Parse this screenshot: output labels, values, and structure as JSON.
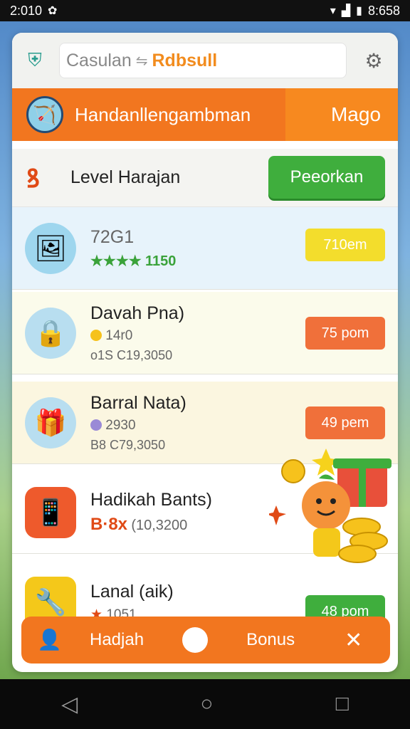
{
  "status": {
    "time": "2:010",
    "right_time": "8:658",
    "icons": [
      "bug-icon",
      "wifi-icon",
      "signal-icon",
      "battery-icon"
    ]
  },
  "header": {
    "search_text": "Casulan",
    "search_brand": "Rdbsull",
    "search_sep": "⇋"
  },
  "banner": {
    "title": "Handanllengambman",
    "right_tab": "Mago"
  },
  "level": {
    "title": "Level Harajan",
    "action": "Peeorkan"
  },
  "items": [
    {
      "name": "72G1",
      "stars": "★★★★",
      "sub": "1150",
      "sub2": "",
      "price": "710em"
    },
    {
      "name": "Davah Pna)",
      "sub": "14r0",
      "sub2": "o1S   C19,3050",
      "price": "75 pom"
    },
    {
      "name": "Barral Nata)",
      "sub": "2930",
      "sub2": "B8   C79,3050",
      "price": "49 pem"
    },
    {
      "name": "Hadikah Bants)",
      "sub": "B·8x",
      "sub2": "(10,3200",
      "price": ""
    },
    {
      "name": "Lanal (aik)",
      "sub": "1051",
      "sub2": "",
      "price": "48 pom"
    }
  ],
  "bottom": {
    "label1": "Hadjah",
    "label2": "Bonus",
    "close": "✕"
  },
  "colors": {
    "orange": "#f2761f",
    "green": "#3fae3d",
    "yellow": "#f3dd2c"
  }
}
